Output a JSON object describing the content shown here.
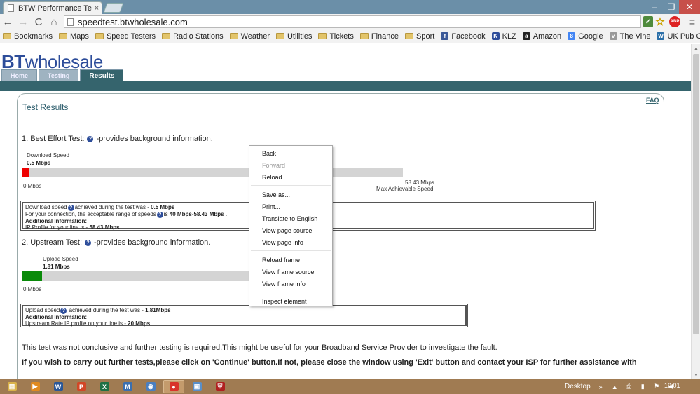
{
  "browser": {
    "tab_title": "BTW Performance Test",
    "tab_close": "×",
    "url": "speedtest.btwholesale.com",
    "window_controls": {
      "minimize": "–",
      "maximize": "❐",
      "close": "✕"
    },
    "nav": {
      "back": "←",
      "forward": "→",
      "reload": "C",
      "home": "⌂"
    },
    "extensions": {
      "green_ext": "✓",
      "star": "☆",
      "abp": "ABP",
      "menu": "≡"
    }
  },
  "bookmarks": [
    {
      "label": "Bookmarks",
      "type": "folder"
    },
    {
      "label": "Maps",
      "type": "folder"
    },
    {
      "label": "Speed Testers",
      "type": "folder"
    },
    {
      "label": "Radio Stations",
      "type": "folder"
    },
    {
      "label": "Weather",
      "type": "folder"
    },
    {
      "label": "Utilities",
      "type": "folder"
    },
    {
      "label": "Tickets",
      "type": "folder"
    },
    {
      "label": "Finance",
      "type": "folder"
    },
    {
      "label": "Sport",
      "type": "folder"
    },
    {
      "label": "Facebook",
      "type": "facebook",
      "glyph": "f"
    },
    {
      "label": "KLZ",
      "type": "klz",
      "glyph": "K"
    },
    {
      "label": "Amazon",
      "type": "amazon",
      "glyph": "a"
    },
    {
      "label": "Google",
      "type": "google",
      "glyph": "8"
    },
    {
      "label": "The Vine",
      "type": "vine",
      "glyph": "v"
    },
    {
      "label": "UK Pub Guide, Cam...",
      "type": "pub",
      "glyph": "W"
    }
  ],
  "site": {
    "logo_bt": "BT",
    "logo_rest": "wholesale",
    "tabs": [
      "Home",
      "Testing",
      "Results"
    ],
    "faq": "FAQ",
    "results_title": "Test Results"
  },
  "download": {
    "heading": "1. Best Effort Test:",
    "heading_suffix": "-provides background information.",
    "label": "Download Speed",
    "value": "0.5 Mbps",
    "axis_min": "0 Mbps",
    "axis_max": "58.43 Mbps",
    "axis_max_caption": "Max Achievable Speed",
    "fill_fraction": 0.018,
    "fill_color": "#ee0000",
    "info": {
      "line1_prefix": "Download speed",
      "line1_mid": "achieved during the test was - ",
      "line1_value": "0.5 Mbps",
      "line2_prefix": "For your connection, the acceptable range of speeds",
      "line2_mid": "is ",
      "line2_value": "40 Mbps-58.43 Mbps",
      "line2_suffix": " .",
      "line3": "Additional Information:",
      "line4_prefix": "IP Profile for your line is - ",
      "line4_value": "58.43 Mbps"
    }
  },
  "upload": {
    "heading": "2. Upstream Test:",
    "heading_suffix": "-provides background information.",
    "label": "Upload Speed",
    "value": "1.81 Mbps",
    "axis_min": "0 Mbps",
    "fill_fraction": 0.09,
    "fill_color": "#0a8a0a",
    "info": {
      "line1_prefix": "Upload speed",
      "line1_mid": " achieved during the test was - ",
      "line1_value": "1.81Mbps",
      "line2": "Additional Information:",
      "line3_prefix": "Upstream Rate IP profile on your line is - ",
      "line3_value": "20 Mbps"
    }
  },
  "footer_text": {
    "line1": "This test was not conclusive and further testing is required.This might be useful for your Broadband Service Provider to investigate the fault.",
    "line2": "If you wish to carry out further tests,please click on 'Continue' button.If not, please close the window using 'Exit' button and contact your ISP for further assistance with"
  },
  "context_menu": {
    "groups": [
      [
        {
          "label": "Back",
          "enabled": true
        },
        {
          "label": "Forward",
          "enabled": false
        },
        {
          "label": "Reload",
          "enabled": true
        }
      ],
      [
        {
          "label": "Save as...",
          "enabled": true
        },
        {
          "label": "Print...",
          "enabled": true
        },
        {
          "label": "Translate to English",
          "enabled": true
        },
        {
          "label": "View page source",
          "enabled": true
        },
        {
          "label": "View page info",
          "enabled": true
        }
      ],
      [
        {
          "label": "Reload frame",
          "enabled": true
        },
        {
          "label": "View frame source",
          "enabled": true
        },
        {
          "label": "View frame info",
          "enabled": true
        }
      ],
      [
        {
          "label": "Inspect element",
          "enabled": true
        }
      ]
    ]
  },
  "taskbar": {
    "apps": [
      {
        "name": "explorer",
        "glyph": "▤",
        "color": "#d9b24a"
      },
      {
        "name": "media",
        "glyph": "▶",
        "color": "#e08a20"
      },
      {
        "name": "word",
        "glyph": "W",
        "color": "#2b5797"
      },
      {
        "name": "powerpoint",
        "glyph": "P",
        "color": "#d24726"
      },
      {
        "name": "excel",
        "glyph": "X",
        "color": "#1e7145"
      },
      {
        "name": "app-m",
        "glyph": "M",
        "color": "#3a6fb0"
      },
      {
        "name": "app-blue",
        "glyph": "◉",
        "color": "#4a7fc1"
      },
      {
        "name": "chrome",
        "glyph": "●",
        "color": "#d9342b"
      },
      {
        "name": "monitor",
        "glyph": "▣",
        "color": "#5a8fc8"
      },
      {
        "name": "shield",
        "glyph": "⛨",
        "color": "#b02020"
      }
    ],
    "desktop_label": "Desktop",
    "clock": "19:01"
  },
  "colors": {
    "brand_blue": "#2d4d9a",
    "header_green": "#35646d",
    "taskbar": "#a07b52"
  }
}
